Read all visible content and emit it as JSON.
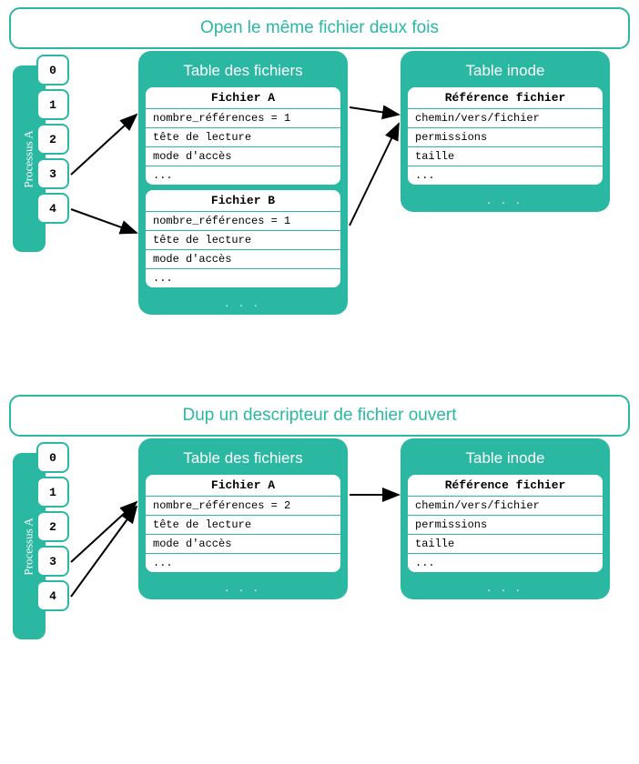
{
  "section1": {
    "title": "Open le même fichier deux fois",
    "process_label": "Processus A",
    "fds": [
      "0",
      "1",
      "2",
      "3",
      "4"
    ],
    "file_table": {
      "title": "Table des fichiers",
      "entries": [
        {
          "name": "Fichier A",
          "rows": [
            "nombre_références = 1",
            "tête de lecture",
            "mode d'accès",
            "..."
          ]
        },
        {
          "name": "Fichier B",
          "rows": [
            "nombre_références = 1",
            "tête de lecture",
            "mode d'accès",
            "..."
          ]
        }
      ],
      "ellipsis": ". . ."
    },
    "inode_table": {
      "title": "Table inode",
      "entries": [
        {
          "name": "Référence fichier",
          "rows": [
            "chemin/vers/fichier",
            "permissions",
            "taille",
            "..."
          ]
        }
      ],
      "ellipsis": ". . ."
    }
  },
  "section2": {
    "title": "Dup un descripteur de fichier ouvert",
    "process_label": "Processus A",
    "fds": [
      "0",
      "1",
      "2",
      "3",
      "4"
    ],
    "file_table": {
      "title": "Table des fichiers",
      "entries": [
        {
          "name": "Fichier A",
          "rows": [
            "nombre_références = 2",
            "tête de lecture",
            "mode d'accès",
            "..."
          ]
        }
      ],
      "ellipsis": ". . ."
    },
    "inode_table": {
      "title": "Table inode",
      "entries": [
        {
          "name": "Référence fichier",
          "rows": [
            "chemin/vers/fichier",
            "permissions",
            "taille",
            "..."
          ]
        }
      ],
      "ellipsis": ". . ."
    }
  }
}
